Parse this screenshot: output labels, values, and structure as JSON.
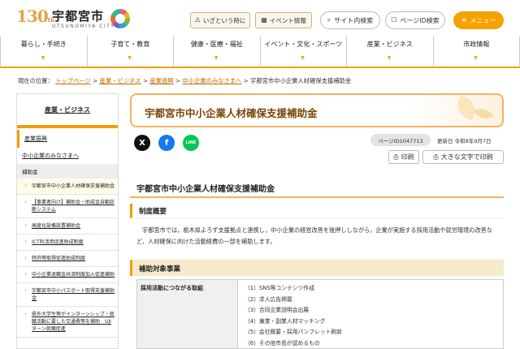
{
  "header": {
    "logo_number": "130",
    "logo_small": "th",
    "logo_city": "宇都宮市",
    "logo_city_en": "UTSUNOMIYA CITY",
    "emergency": "いざという時に",
    "event": "イベント情報",
    "site_search": "サイト内検索",
    "page_id_search": "ページID検索",
    "menu": "メニュー"
  },
  "nav": [
    "暮らし・手続き",
    "子育て・教育",
    "健康・医療・福祉",
    "イベント・文化・スポーツ",
    "産業・ビジネス",
    "市政情報"
  ],
  "breadcrumb": {
    "prefix": "現在の位置：",
    "items": [
      "トップページ",
      "産業・ビジネス",
      "産業振興",
      "中小企業のみなさまへ"
    ],
    "sep": ">",
    "current": "宇都宮市中小企業人材確保支援補助金"
  },
  "sidebar": {
    "title": "産業・ビジネス",
    "level1": "産業振興",
    "level2": "中小企業のみなさまへ",
    "level3": "補助金",
    "items": [
      "宇都宮市中小企業人材確保支援補助金",
      "【事業者向け】補助金・助成金自動診断システム",
      "高度化設備設置補助金",
      "ICT利活用促進助成制度",
      "特許等取得促進助成制度",
      "中小企業退職金共済制度加入促進補助",
      "宇都宮市中小パスポート取得支援補助金",
      "県外大学生等がインターンシップ・就職活動に要した交通費等を補助　UJIターン就職促進"
    ]
  },
  "page": {
    "title": "宇都宮市中小企業人材確保支援補助金",
    "page_id": "ページID1047713",
    "updated": "更新日 令和8年9月7日",
    "print": "印刷",
    "large_print": "大きな文字で印刷",
    "h2": "宇都宮市中小企業人材確保支援補助金",
    "h3_overview": "制度概要",
    "overview_text": "宇都宮市では，栃木県よろず支援拠点と連携し，中小企業の経営改善を後押ししながら，企業が実施する採用活動や就労環境の改善など，人材確保に向けた活動経費の一部を補助します。",
    "h3_targets": "補助対象事業",
    "table_header": "採用活動につながる取組",
    "table_items": [
      "（1）SNS等コンテンツ作成",
      "（2）求人広告掲載",
      "（3）合同企業説明会出展",
      "（4）兼業・副業人材マッチング",
      "（5）会社概要・採用パンフレット刷新",
      "（6）その他市長が認めるもの"
    ]
  },
  "share": {
    "x": "X",
    "facebook": "f",
    "line": "LINE"
  },
  "colors": {
    "accent": "#f29e00",
    "title_border": "#f2b460",
    "title_text": "#7a4400",
    "link": "#c46a00",
    "x": "#111111",
    "facebook": "#1877f2",
    "line": "#06c755"
  },
  "icons": [
    "alert-icon",
    "calendar-icon",
    "search-icon",
    "id-search-icon",
    "menu-icon",
    "print-icon",
    "large-print-icon",
    "chevron-down-icon"
  ]
}
